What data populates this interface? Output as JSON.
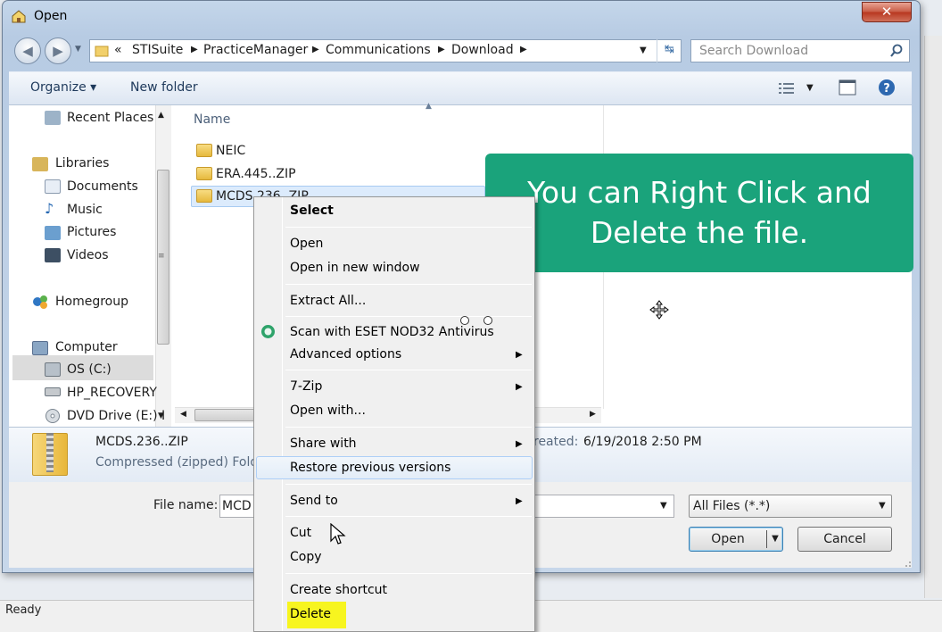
{
  "window": {
    "title": "Open",
    "close_label": "✕"
  },
  "address": {
    "prefix": "«",
    "crumbs": [
      "STISuite",
      "PracticeManager",
      "Communications",
      "Download"
    ],
    "search_placeholder": "Search Download"
  },
  "toolbar": {
    "organize_label": "Organize ▾",
    "new_folder_label": "New folder"
  },
  "nav": {
    "items": [
      "Recent Places",
      "Libraries",
      "Documents",
      "Music",
      "Pictures",
      "Videos",
      "Homegroup",
      "Computer",
      "OS (C:)",
      "HP_RECOVERY",
      "DVD Drive (E:) I"
    ]
  },
  "files": {
    "column_header": "Name",
    "items": [
      "NEIC",
      "ERA.445..ZIP",
      "MCDS.236..ZIP"
    ]
  },
  "details": {
    "name": "MCDS.236..ZIP",
    "type": "Compressed (zipped) Folde",
    "created_label": "reated:",
    "created_value": "6/19/2018 2:50 PM"
  },
  "bottom": {
    "file_name_label": "File name:",
    "file_name_value": "MCD",
    "file_type_value": "All Files (*.*)",
    "open_label": "Open",
    "cancel_label": "Cancel"
  },
  "context_menu": {
    "items": [
      "Select",
      "Open",
      "Open in new window",
      "Extract All...",
      "Scan with ESET NOD32 Antivirus",
      "Advanced options",
      "7-Zip",
      "Open with...",
      "Share with",
      "Restore previous versions",
      "Send to",
      "Cut",
      "Copy",
      "Create shortcut",
      "Delete"
    ]
  },
  "callout": {
    "line1": "You can Right Click and",
    "line2": "Delete the file."
  },
  "status": {
    "text": "Ready"
  },
  "colors": {
    "callout": "#1aa37b",
    "highlight": "#f7f51f"
  }
}
